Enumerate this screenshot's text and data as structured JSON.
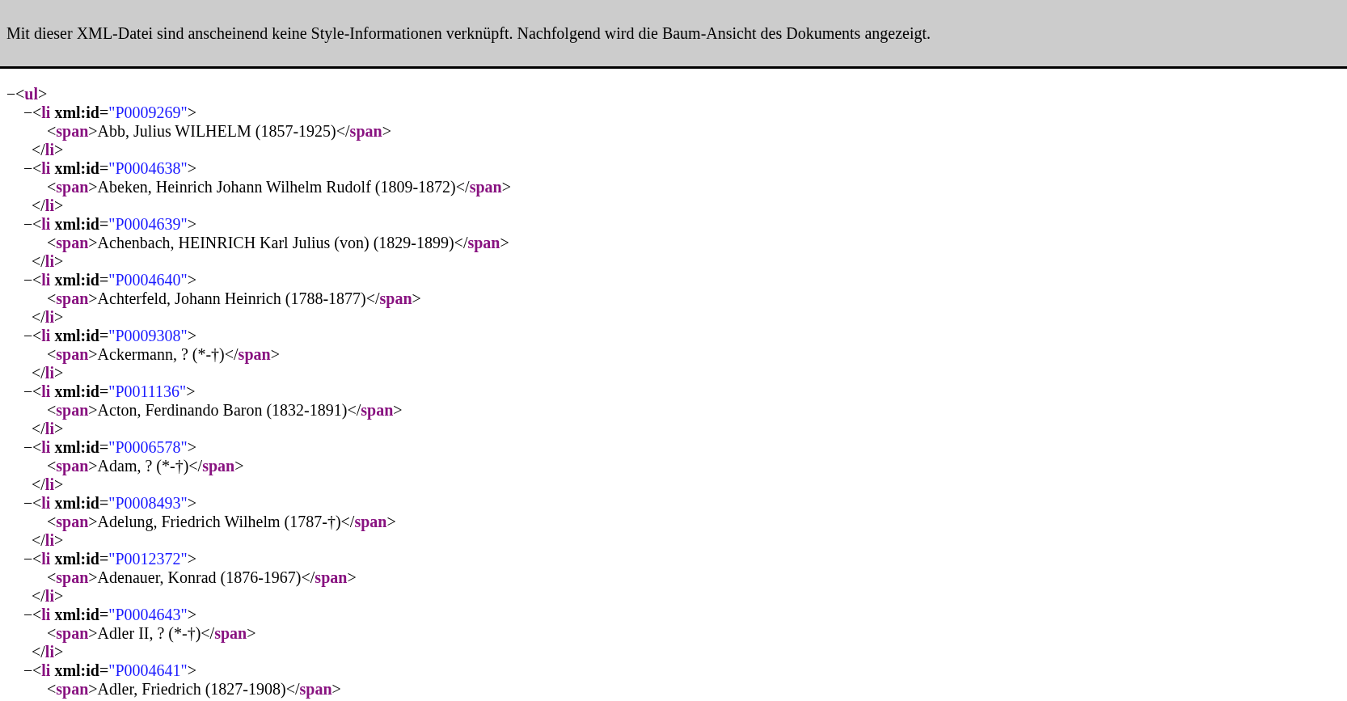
{
  "banner": {
    "message": "Mit dieser XML-Datei sind anscheinend keine Style-Informationen verknüpft. Nachfolgend wird die Baum-Ansicht des Dokuments angezeigt."
  },
  "tree": {
    "toggle": "−",
    "expanded": true,
    "open_tag": [
      {
        "kind": "punct",
        "text": "<"
      },
      {
        "kind": "tag",
        "text": "ul"
      },
      {
        "kind": "punct",
        "text": ">"
      }
    ],
    "children": [
      {
        "toggle": "−",
        "expanded": true,
        "open_tag": [
          {
            "kind": "punct",
            "text": "<"
          },
          {
            "kind": "tag",
            "text": "li"
          },
          {
            "kind": "attr",
            "text": "xml:id"
          },
          {
            "kind": "punct",
            "text": "="
          },
          {
            "kind": "value",
            "text": "\"P0009269\""
          },
          {
            "kind": "punct",
            "text": ">"
          }
        ],
        "children": [
          {
            "line": [
              {
                "kind": "punct",
                "text": "<"
              },
              {
                "kind": "tag",
                "text": "span"
              },
              {
                "kind": "punct",
                "text": ">"
              },
              {
                "kind": "text",
                "text": "Abb, Julius WILHELM (1857-1925)"
              },
              {
                "kind": "punct",
                "text": "</"
              },
              {
                "kind": "tag",
                "text": "span"
              },
              {
                "kind": "punct",
                "text": ">"
              }
            ]
          }
        ],
        "close_tag": [
          {
            "kind": "punct",
            "text": "</"
          },
          {
            "kind": "tag",
            "text": "li"
          },
          {
            "kind": "punct",
            "text": ">"
          }
        ]
      },
      {
        "toggle": "−",
        "expanded": true,
        "open_tag": [
          {
            "kind": "punct",
            "text": "<"
          },
          {
            "kind": "tag",
            "text": "li"
          },
          {
            "kind": "attr",
            "text": "xml:id"
          },
          {
            "kind": "punct",
            "text": "="
          },
          {
            "kind": "value",
            "text": "\"P0004638\""
          },
          {
            "kind": "punct",
            "text": ">"
          }
        ],
        "children": [
          {
            "line": [
              {
                "kind": "punct",
                "text": "<"
              },
              {
                "kind": "tag",
                "text": "span"
              },
              {
                "kind": "punct",
                "text": ">"
              },
              {
                "kind": "text",
                "text": "Abeken, Heinrich Johann Wilhelm Rudolf (1809-1872)"
              },
              {
                "kind": "punct",
                "text": "</"
              },
              {
                "kind": "tag",
                "text": "span"
              },
              {
                "kind": "punct",
                "text": ">"
              }
            ]
          }
        ],
        "close_tag": [
          {
            "kind": "punct",
            "text": "</"
          },
          {
            "kind": "tag",
            "text": "li"
          },
          {
            "kind": "punct",
            "text": ">"
          }
        ]
      },
      {
        "toggle": "−",
        "expanded": true,
        "open_tag": [
          {
            "kind": "punct",
            "text": "<"
          },
          {
            "kind": "tag",
            "text": "li"
          },
          {
            "kind": "attr",
            "text": "xml:id"
          },
          {
            "kind": "punct",
            "text": "="
          },
          {
            "kind": "value",
            "text": "\"P0004639\""
          },
          {
            "kind": "punct",
            "text": ">"
          }
        ],
        "children": [
          {
            "line": [
              {
                "kind": "punct",
                "text": "<"
              },
              {
                "kind": "tag",
                "text": "span"
              },
              {
                "kind": "punct",
                "text": ">"
              },
              {
                "kind": "text",
                "text": "Achenbach, HEINRICH Karl Julius (von) (1829-1899)"
              },
              {
                "kind": "punct",
                "text": "</"
              },
              {
                "kind": "tag",
                "text": "span"
              },
              {
                "kind": "punct",
                "text": ">"
              }
            ]
          }
        ],
        "close_tag": [
          {
            "kind": "punct",
            "text": "</"
          },
          {
            "kind": "tag",
            "text": "li"
          },
          {
            "kind": "punct",
            "text": ">"
          }
        ]
      },
      {
        "toggle": "−",
        "expanded": true,
        "open_tag": [
          {
            "kind": "punct",
            "text": "<"
          },
          {
            "kind": "tag",
            "text": "li"
          },
          {
            "kind": "attr",
            "text": "xml:id"
          },
          {
            "kind": "punct",
            "text": "="
          },
          {
            "kind": "value",
            "text": "\"P0004640\""
          },
          {
            "kind": "punct",
            "text": ">"
          }
        ],
        "children": [
          {
            "line": [
              {
                "kind": "punct",
                "text": "<"
              },
              {
                "kind": "tag",
                "text": "span"
              },
              {
                "kind": "punct",
                "text": ">"
              },
              {
                "kind": "text",
                "text": "Achterfeld, Johann Heinrich (1788-1877)"
              },
              {
                "kind": "punct",
                "text": "</"
              },
              {
                "kind": "tag",
                "text": "span"
              },
              {
                "kind": "punct",
                "text": ">"
              }
            ]
          }
        ],
        "close_tag": [
          {
            "kind": "punct",
            "text": "</"
          },
          {
            "kind": "tag",
            "text": "li"
          },
          {
            "kind": "punct",
            "text": ">"
          }
        ]
      },
      {
        "toggle": "−",
        "expanded": true,
        "open_tag": [
          {
            "kind": "punct",
            "text": "<"
          },
          {
            "kind": "tag",
            "text": "li"
          },
          {
            "kind": "attr",
            "text": "xml:id"
          },
          {
            "kind": "punct",
            "text": "="
          },
          {
            "kind": "value",
            "text": "\"P0009308\""
          },
          {
            "kind": "punct",
            "text": ">"
          }
        ],
        "children": [
          {
            "line": [
              {
                "kind": "punct",
                "text": "<"
              },
              {
                "kind": "tag",
                "text": "span"
              },
              {
                "kind": "punct",
                "text": ">"
              },
              {
                "kind": "text",
                "text": "Ackermann, ? (*-†)"
              },
              {
                "kind": "punct",
                "text": "</"
              },
              {
                "kind": "tag",
                "text": "span"
              },
              {
                "kind": "punct",
                "text": ">"
              }
            ]
          }
        ],
        "close_tag": [
          {
            "kind": "punct",
            "text": "</"
          },
          {
            "kind": "tag",
            "text": "li"
          },
          {
            "kind": "punct",
            "text": ">"
          }
        ]
      },
      {
        "toggle": "−",
        "expanded": true,
        "open_tag": [
          {
            "kind": "punct",
            "text": "<"
          },
          {
            "kind": "tag",
            "text": "li"
          },
          {
            "kind": "attr",
            "text": "xml:id"
          },
          {
            "kind": "punct",
            "text": "="
          },
          {
            "kind": "value",
            "text": "\"P0011136\""
          },
          {
            "kind": "punct",
            "text": ">"
          }
        ],
        "children": [
          {
            "line": [
              {
                "kind": "punct",
                "text": "<"
              },
              {
                "kind": "tag",
                "text": "span"
              },
              {
                "kind": "punct",
                "text": ">"
              },
              {
                "kind": "text",
                "text": "Acton, Ferdinando Baron (1832-1891)"
              },
              {
                "kind": "punct",
                "text": "</"
              },
              {
                "kind": "tag",
                "text": "span"
              },
              {
                "kind": "punct",
                "text": ">"
              }
            ]
          }
        ],
        "close_tag": [
          {
            "kind": "punct",
            "text": "</"
          },
          {
            "kind": "tag",
            "text": "li"
          },
          {
            "kind": "punct",
            "text": ">"
          }
        ]
      },
      {
        "toggle": "−",
        "expanded": true,
        "open_tag": [
          {
            "kind": "punct",
            "text": "<"
          },
          {
            "kind": "tag",
            "text": "li"
          },
          {
            "kind": "attr",
            "text": "xml:id"
          },
          {
            "kind": "punct",
            "text": "="
          },
          {
            "kind": "value",
            "text": "\"P0006578\""
          },
          {
            "kind": "punct",
            "text": ">"
          }
        ],
        "children": [
          {
            "line": [
              {
                "kind": "punct",
                "text": "<"
              },
              {
                "kind": "tag",
                "text": "span"
              },
              {
                "kind": "punct",
                "text": ">"
              },
              {
                "kind": "text",
                "text": "Adam, ? (*-†)"
              },
              {
                "kind": "punct",
                "text": "</"
              },
              {
                "kind": "tag",
                "text": "span"
              },
              {
                "kind": "punct",
                "text": ">"
              }
            ]
          }
        ],
        "close_tag": [
          {
            "kind": "punct",
            "text": "</"
          },
          {
            "kind": "tag",
            "text": "li"
          },
          {
            "kind": "punct",
            "text": ">"
          }
        ]
      },
      {
        "toggle": "−",
        "expanded": true,
        "open_tag": [
          {
            "kind": "punct",
            "text": "<"
          },
          {
            "kind": "tag",
            "text": "li"
          },
          {
            "kind": "attr",
            "text": "xml:id"
          },
          {
            "kind": "punct",
            "text": "="
          },
          {
            "kind": "value",
            "text": "\"P0008493\""
          },
          {
            "kind": "punct",
            "text": ">"
          }
        ],
        "children": [
          {
            "line": [
              {
                "kind": "punct",
                "text": "<"
              },
              {
                "kind": "tag",
                "text": "span"
              },
              {
                "kind": "punct",
                "text": ">"
              },
              {
                "kind": "text",
                "text": "Adelung, Friedrich Wilhelm (1787-†)"
              },
              {
                "kind": "punct",
                "text": "</"
              },
              {
                "kind": "tag",
                "text": "span"
              },
              {
                "kind": "punct",
                "text": ">"
              }
            ]
          }
        ],
        "close_tag": [
          {
            "kind": "punct",
            "text": "</"
          },
          {
            "kind": "tag",
            "text": "li"
          },
          {
            "kind": "punct",
            "text": ">"
          }
        ]
      },
      {
        "toggle": "−",
        "expanded": true,
        "open_tag": [
          {
            "kind": "punct",
            "text": "<"
          },
          {
            "kind": "tag",
            "text": "li"
          },
          {
            "kind": "attr",
            "text": "xml:id"
          },
          {
            "kind": "punct",
            "text": "="
          },
          {
            "kind": "value",
            "text": "\"P0012372\""
          },
          {
            "kind": "punct",
            "text": ">"
          }
        ],
        "children": [
          {
            "line": [
              {
                "kind": "punct",
                "text": "<"
              },
              {
                "kind": "tag",
                "text": "span"
              },
              {
                "kind": "punct",
                "text": ">"
              },
              {
                "kind": "text",
                "text": "Adenauer, Konrad (1876-1967)"
              },
              {
                "kind": "punct",
                "text": "</"
              },
              {
                "kind": "tag",
                "text": "span"
              },
              {
                "kind": "punct",
                "text": ">"
              }
            ]
          }
        ],
        "close_tag": [
          {
            "kind": "punct",
            "text": "</"
          },
          {
            "kind": "tag",
            "text": "li"
          },
          {
            "kind": "punct",
            "text": ">"
          }
        ]
      },
      {
        "toggle": "−",
        "expanded": true,
        "open_tag": [
          {
            "kind": "punct",
            "text": "<"
          },
          {
            "kind": "tag",
            "text": "li"
          },
          {
            "kind": "attr",
            "text": "xml:id"
          },
          {
            "kind": "punct",
            "text": "="
          },
          {
            "kind": "value",
            "text": "\"P0004643\""
          },
          {
            "kind": "punct",
            "text": ">"
          }
        ],
        "children": [
          {
            "line": [
              {
                "kind": "punct",
                "text": "<"
              },
              {
                "kind": "tag",
                "text": "span"
              },
              {
                "kind": "punct",
                "text": ">"
              },
              {
                "kind": "text",
                "text": "Adler II, ? (*-†)"
              },
              {
                "kind": "punct",
                "text": "</"
              },
              {
                "kind": "tag",
                "text": "span"
              },
              {
                "kind": "punct",
                "text": ">"
              }
            ]
          }
        ],
        "close_tag": [
          {
            "kind": "punct",
            "text": "</"
          },
          {
            "kind": "tag",
            "text": "li"
          },
          {
            "kind": "punct",
            "text": ">"
          }
        ]
      },
      {
        "toggle": "−",
        "expanded": true,
        "open_tag": [
          {
            "kind": "punct",
            "text": "<"
          },
          {
            "kind": "tag",
            "text": "li"
          },
          {
            "kind": "attr",
            "text": "xml:id"
          },
          {
            "kind": "punct",
            "text": "="
          },
          {
            "kind": "value",
            "text": "\"P0004641\""
          },
          {
            "kind": "punct",
            "text": ">"
          }
        ],
        "children": [
          {
            "line": [
              {
                "kind": "punct",
                "text": "<"
              },
              {
                "kind": "tag",
                "text": "span"
              },
              {
                "kind": "punct",
                "text": ">"
              },
              {
                "kind": "text",
                "text": "Adler, Friedrich (1827-1908)"
              },
              {
                "kind": "punct",
                "text": "</"
              },
              {
                "kind": "tag",
                "text": "span"
              },
              {
                "kind": "punct",
                "text": ">"
              }
            ]
          }
        ]
      }
    ]
  }
}
